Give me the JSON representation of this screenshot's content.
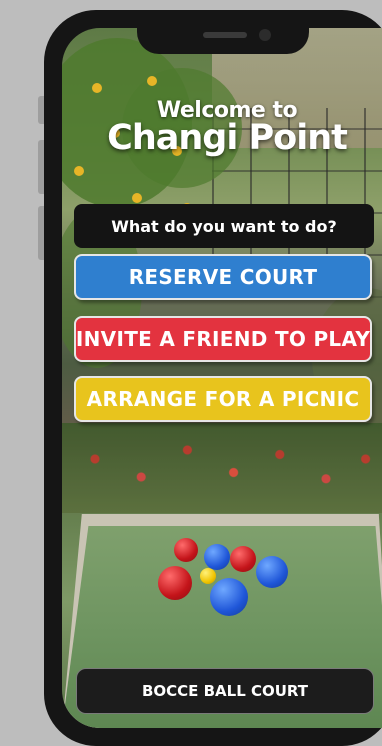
{
  "header": {
    "welcome_line": "Welcome to",
    "venue_name": "Changi Point"
  },
  "prompt": {
    "question": "What do you want to do?"
  },
  "actions": [
    {
      "label": "RESERVE COURT",
      "color": "#2f7fcf"
    },
    {
      "label": "INVITE A FRIEND TO PLAY",
      "color": "#e3333f"
    },
    {
      "label": "ARRANGE FOR A PICNIC",
      "color": "#e8c41d"
    }
  ],
  "footer": {
    "court_label": "BOCCE BALL COURT"
  }
}
